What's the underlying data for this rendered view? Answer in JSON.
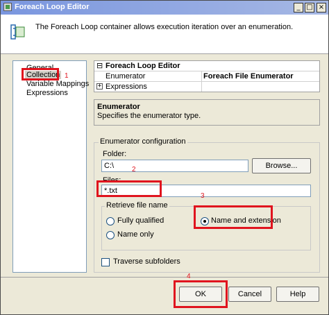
{
  "window": {
    "title": "Foreach Loop Editor",
    "minimize": "_",
    "maximize": "□",
    "close": "×"
  },
  "header": {
    "description": "The Foreach Loop container allows execution iteration over an enumeration."
  },
  "nav": {
    "items": [
      "General",
      "Collection",
      "Variable Mappings",
      "Expressions"
    ]
  },
  "grid": {
    "section_title": "Foreach Loop Editor",
    "collapse_glyph": "⊟",
    "expand_glyph": "+",
    "enumerator_label": "Enumerator",
    "enumerator_value": "Foreach File Enumerator",
    "expressions_label": "Expressions"
  },
  "description_panel": {
    "title": "Enumerator",
    "text": "Specifies the enumerator type."
  },
  "config": {
    "group_title": "Enumerator configuration",
    "folder_label": "Folder:",
    "folder_value": "C:\\",
    "browse_label": "Browse...",
    "files_label": "Files:",
    "files_value": "*.txt",
    "retrieve_title": "Retrieve file name",
    "opt_fully_qualified": "Fully qualified",
    "opt_name_extension": "Name and extension",
    "opt_name_only": "Name only",
    "selected_option": "Name and extension",
    "traverse_label": "Traverse subfolders",
    "traverse_checked": false
  },
  "buttons": {
    "ok": "OK",
    "cancel": "Cancel",
    "help": "Help"
  },
  "annotations": {
    "n1": "1",
    "n2": "2",
    "n3": "3",
    "n4": "4",
    "color": "#e0141e"
  }
}
